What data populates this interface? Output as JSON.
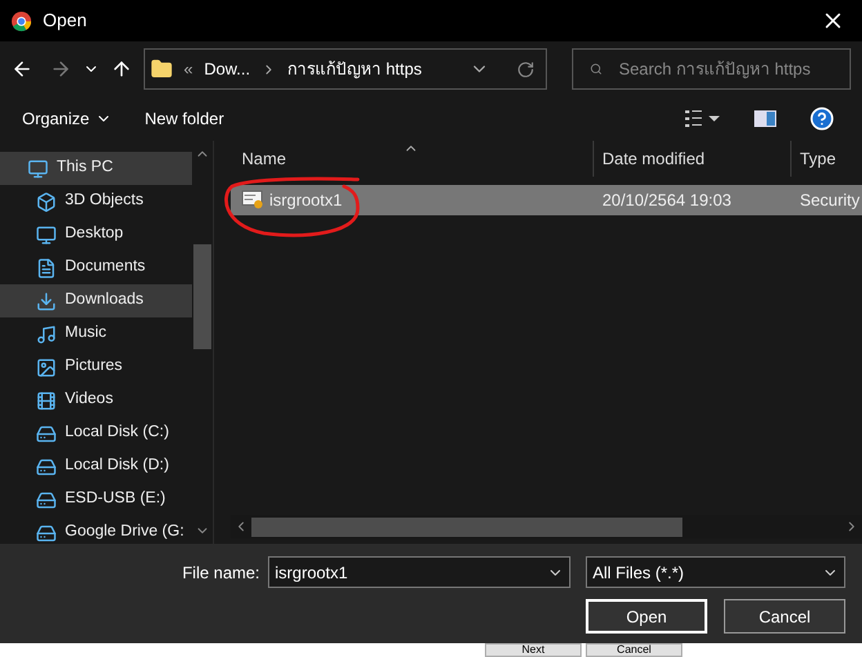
{
  "window": {
    "title": "Open"
  },
  "nav": {
    "breadcrumb_overflow": "«",
    "breadcrumbs": [
      "Dow...",
      "การแก้ปัญหา https"
    ],
    "search": {
      "placeholder": "Search การแก้ปัญหา https"
    }
  },
  "toolbar": {
    "organize": "Organize",
    "new_folder": "New folder"
  },
  "sidebar": {
    "items": [
      {
        "label": "This PC",
        "selected": true,
        "children": [
          {
            "label": "3D Objects",
            "selected": false
          },
          {
            "label": "Desktop",
            "selected": false
          },
          {
            "label": "Documents",
            "selected": false
          },
          {
            "label": "Downloads",
            "selected": true
          },
          {
            "label": "Music",
            "selected": false
          },
          {
            "label": "Pictures",
            "selected": false
          },
          {
            "label": "Videos",
            "selected": false
          },
          {
            "label": "Local Disk (C:)",
            "selected": false
          },
          {
            "label": "Local Disk (D:)",
            "selected": false
          },
          {
            "label": "ESD-USB (E:)",
            "selected": false
          },
          {
            "label": "Google Drive (G:",
            "selected": false
          }
        ]
      }
    ]
  },
  "table": {
    "columns": [
      "Name",
      "Date modified",
      "Type"
    ],
    "rows": [
      {
        "name": "isrgrootx1",
        "date": "20/10/2564 19:03",
        "type": "Security",
        "selected": true
      }
    ]
  },
  "footer": {
    "file_name_label": "File name:",
    "file_name": "isrgrootx1",
    "filter": "All Files (*.*)",
    "buttons": [
      "Open",
      "Cancel"
    ]
  },
  "background_window": {
    "buttons": [
      "Next",
      "Cancel"
    ]
  }
}
